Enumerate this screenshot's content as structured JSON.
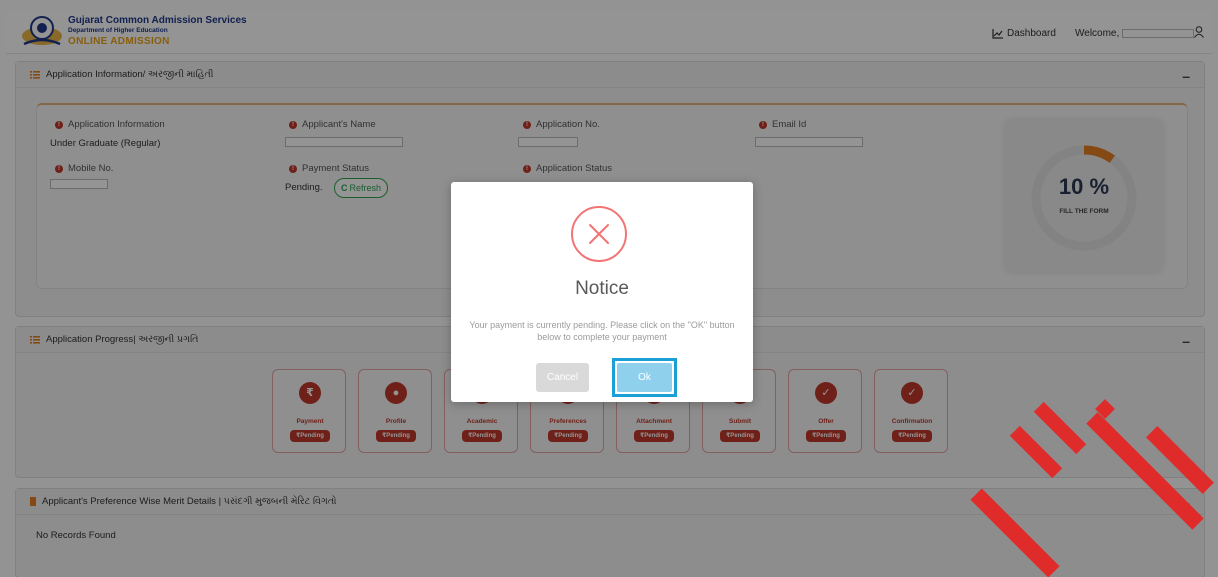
{
  "header": {
    "brand_line1": "Gujarat Common Admission Services",
    "brand_line2": "Department of Higher Education",
    "brand_line3": "ONLINE ADMISSION",
    "dashboard_label": "Dashboard",
    "welcome_label": "Welcome,"
  },
  "app_info_panel": {
    "title": "Application Information/ અરજીની માહિતી",
    "fields": {
      "app_info_label": "Application Information",
      "app_info_value": "Under Graduate (Regular)",
      "name_label": "Applicant's Name",
      "app_no_label": "Application No.",
      "email_label": "Email Id",
      "mobile_label": "Mobile No.",
      "payment_status_label": "Payment Status",
      "payment_status_value": "Pending.",
      "refresh_label": "Refresh",
      "app_status_label": "Application Status"
    },
    "progress": {
      "percent_text": "10 %",
      "percent_value": 10,
      "caption": "FILL THE FORM"
    }
  },
  "progress_panel": {
    "title": "Application Progress| અરજીની પ્રગતિ",
    "steps": [
      {
        "label": "Payment",
        "status": "₹Pending",
        "icon": "rupee-icon"
      },
      {
        "label": "Profile",
        "status": "₹Pending",
        "icon": "user-icon"
      },
      {
        "label": "Academic",
        "status": "₹Pending",
        "icon": "book-icon"
      },
      {
        "label": "Preferences",
        "status": "₹Pending",
        "icon": "list-icon"
      },
      {
        "label": "Attachment",
        "status": "₹Pending",
        "icon": "paperclip-icon"
      },
      {
        "label": "Submit",
        "status": "₹Pending",
        "icon": "send-icon"
      },
      {
        "label": "Offer",
        "status": "₹Pending",
        "icon": "check-icon"
      },
      {
        "label": "Confirmation",
        "status": "₹Pending",
        "icon": "check-icon"
      }
    ]
  },
  "merit_panel": {
    "title": "Applicant's Preference Wise Merit Details | પસંદગી મુજબની મેરિટ વિગતો",
    "empty_text": "No Records Found"
  },
  "modal": {
    "title": "Notice",
    "message": "Your payment is currently pending. Please click on the \"OK\" button below to complete your payment",
    "cancel_label": "Cancel",
    "ok_label": "Ok",
    "icon": "error-x-icon"
  },
  "colors": {
    "accent_red": "#c0392b",
    "brand_blue": "#1f3a8a",
    "brand_orange": "#e8a317",
    "ok_blue": "#8fd0ec",
    "watermark_red": "#e02b2b"
  }
}
